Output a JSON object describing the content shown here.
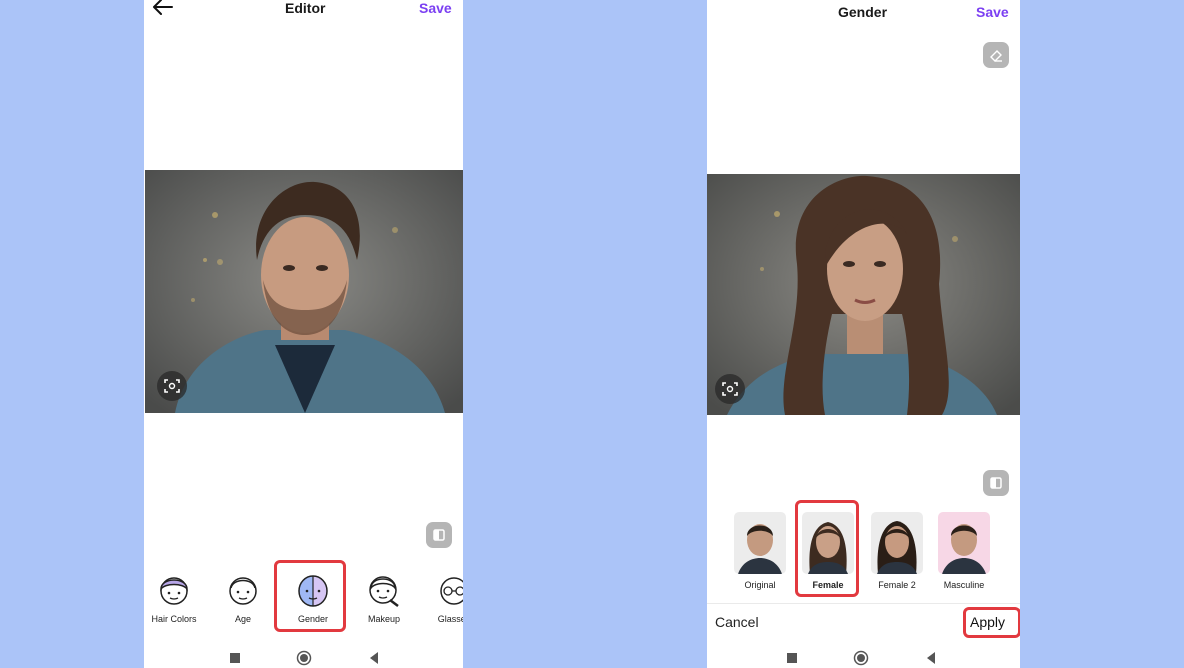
{
  "left_screen": {
    "header": {
      "title": "Editor",
      "save_label": "Save",
      "back_icon": "arrow-left-icon"
    },
    "tools": [
      {
        "label": "Hair Colors",
        "icon": "hair-colors-icon"
      },
      {
        "label": "Age",
        "icon": "age-icon"
      },
      {
        "label": "Gender",
        "icon": "gender-icon"
      },
      {
        "label": "Makeup",
        "icon": "makeup-icon"
      },
      {
        "label": "Glasses",
        "icon": "glasses-icon"
      }
    ],
    "selected_tool": "Gender"
  },
  "right_screen": {
    "header": {
      "title": "Gender",
      "save_label": "Save"
    },
    "options": [
      {
        "label": "Original"
      },
      {
        "label": "Female"
      },
      {
        "label": "Female 2"
      },
      {
        "label": "Masculine"
      }
    ],
    "selected_option": "Female",
    "footer": {
      "cancel_label": "Cancel",
      "apply_label": "Apply"
    }
  },
  "colors": {
    "accent": "#7b3ff2",
    "highlight": "#e2393f",
    "background": "#abc4f8"
  }
}
